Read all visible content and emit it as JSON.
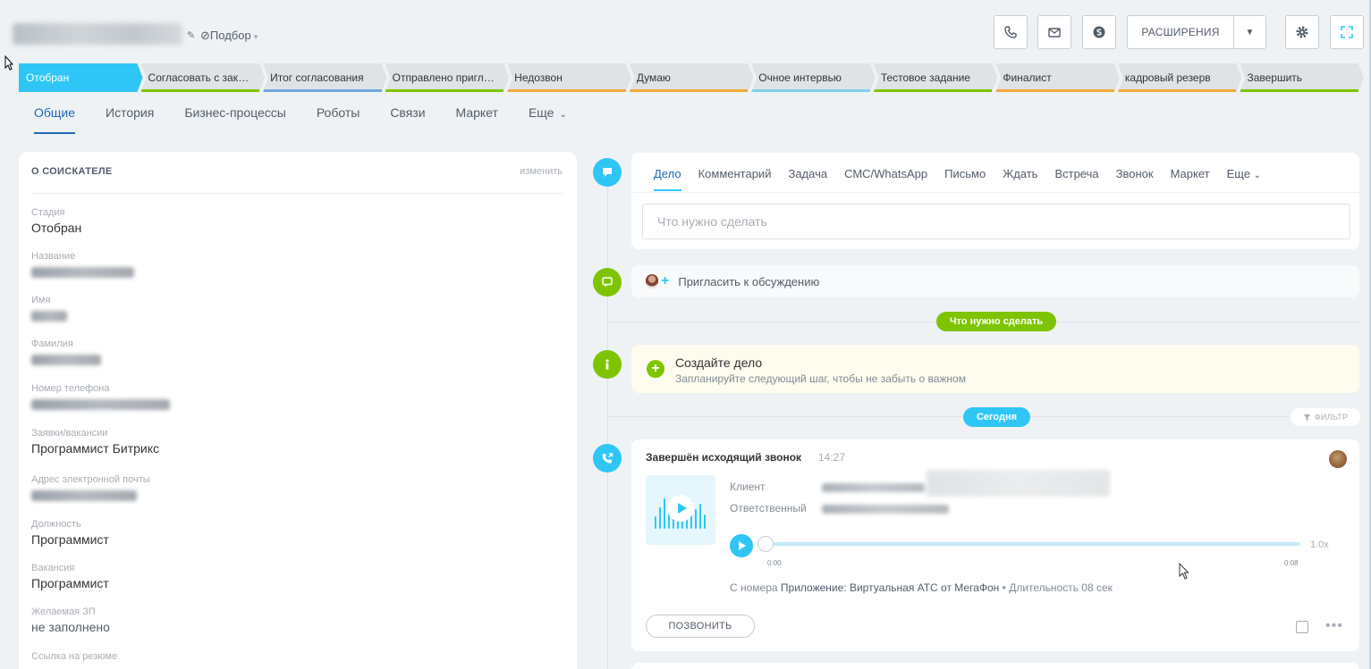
{
  "header": {
    "category": "Подбор",
    "extensions_label": "РАСШИРЕНИЯ"
  },
  "stages": [
    {
      "label": "Отобран",
      "color": "#2fc6f6",
      "active": true
    },
    {
      "label": "Согласовать с заказчиком",
      "color": "#7fc400"
    },
    {
      "label": "Итог согласования",
      "color": "#6fa8dc"
    },
    {
      "label": "Отправлено приглашение",
      "color": "#7fc400"
    },
    {
      "label": "Недозвон",
      "color": "#f2a93b"
    },
    {
      "label": "Думаю",
      "color": "#f2a93b"
    },
    {
      "label": "Очное интервью",
      "color": "#7fd1e8"
    },
    {
      "label": "Тестовое задание",
      "color": "#7fc400"
    },
    {
      "label": "Финалист",
      "color": "#f2a93b"
    },
    {
      "label": "кадровый резерв",
      "color": "#f2a93b"
    },
    {
      "label": "Завершить",
      "color": "#7fc400"
    }
  ],
  "tabs": [
    "Общие",
    "История",
    "Бизнес-процессы",
    "Роботы",
    "Связи",
    "Маркет",
    "Еще"
  ],
  "candidate": {
    "section_title": "О СОИСКАТЕЛЕ",
    "edit_label": "изменить",
    "fields": {
      "stage": {
        "label": "Стадия",
        "value": "Отобран"
      },
      "name": {
        "label": "Название"
      },
      "first_name": {
        "label": "Имя"
      },
      "last_name": {
        "label": "Фамилия"
      },
      "phone": {
        "label": "Номер телефона"
      },
      "vacancy_request": {
        "label": "Заявки/вакансии",
        "value": "Программист Битрикс"
      },
      "email": {
        "label": "Адрес электронной почты"
      },
      "position": {
        "label": "Должность",
        "value": "Программист"
      },
      "vacancy": {
        "label": "Вакансия",
        "value": "Программист"
      },
      "salary": {
        "label": "Желаемая ЗП",
        "value": "не заполнено"
      },
      "resume": {
        "label": "Ссылка на резюме"
      }
    }
  },
  "editor": {
    "tabs": [
      "Дело",
      "Комментарий",
      "Задача",
      "СМС/WhatsApp",
      "Письмо",
      "Ждать",
      "Встреча",
      "Звонок",
      "Маркет",
      "Еще"
    ],
    "placeholder": "Что нужно сделать"
  },
  "invite_text": "Пригласить к обсуждению",
  "todo_pill": "Что нужно сделать",
  "notice": {
    "title": "Создайте дело",
    "subtitle": "Запланируйте следующий шаг, чтобы не забыть о важном"
  },
  "today_pill": "Сегодня",
  "filter_label": "ФИЛЬТР",
  "call": {
    "title": "Завершён исходящий звонок",
    "time": "14:27",
    "client_label": "Клиент",
    "responsible_label": "Ответственный",
    "speed": "1.0x",
    "time_start": "0:00",
    "time_end": "0:08",
    "from_prefix": "С номера",
    "from_value": "Приложение: Виртуальная АТС от МегаФон",
    "duration": "• Длительность 08 сек",
    "call_button": "ПОЗВОНИТЬ"
  },
  "colors": {
    "accent": "#2fc6f6",
    "green": "#7fc400",
    "link": "#1f6ab5"
  }
}
